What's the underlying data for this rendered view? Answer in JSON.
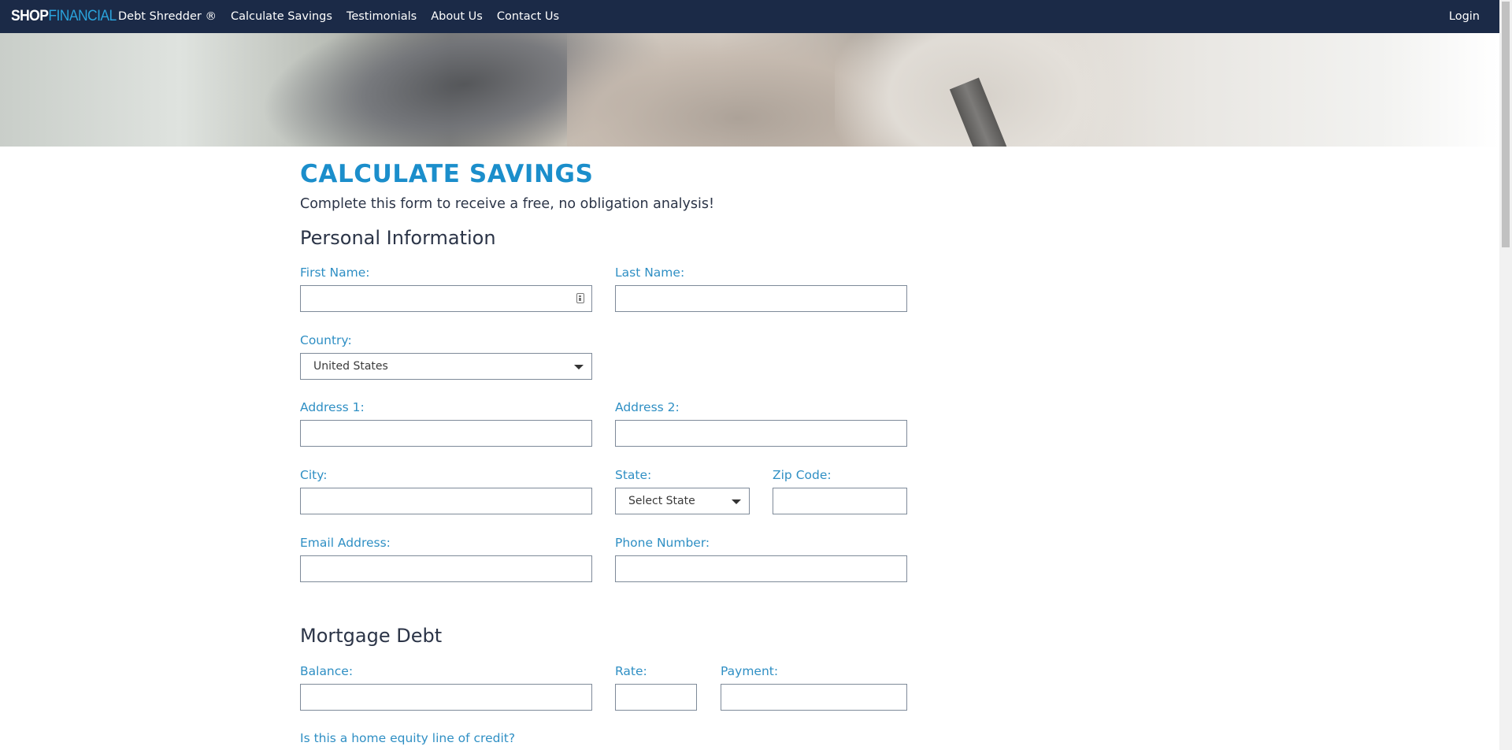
{
  "nav": {
    "brand_part1": "SHOP",
    "brand_part2": "FINANCIAL",
    "links": [
      "Debt Shredder ®",
      "Calculate Savings",
      "Testimonials",
      "About Us",
      "Contact Us"
    ],
    "login": "Login"
  },
  "page": {
    "title": "CALCULATE SAVINGS",
    "subtitle": "Complete this form to receive a free, no obligation analysis!"
  },
  "personal": {
    "heading": "Personal Information",
    "first_name_label": "First Name:",
    "last_name_label": "Last Name:",
    "country_label": "Country:",
    "country_value": "United States",
    "address1_label": "Address 1:",
    "address2_label": "Address 2:",
    "city_label": "City:",
    "state_label": "State:",
    "state_value": "Select State",
    "zip_label": "Zip Code:",
    "email_label": "Email Address:",
    "phone_label": "Phone Number:"
  },
  "mortgage": {
    "heading": "Mortgage Debt",
    "balance_label": "Balance:",
    "rate_label": "Rate:",
    "payment_label": "Payment:",
    "heloc_question": "Is this a home equity line of credit?"
  },
  "colors": {
    "navbar": "#1b2a47",
    "accent": "#1b8ecb",
    "label": "#2f8fc4"
  }
}
